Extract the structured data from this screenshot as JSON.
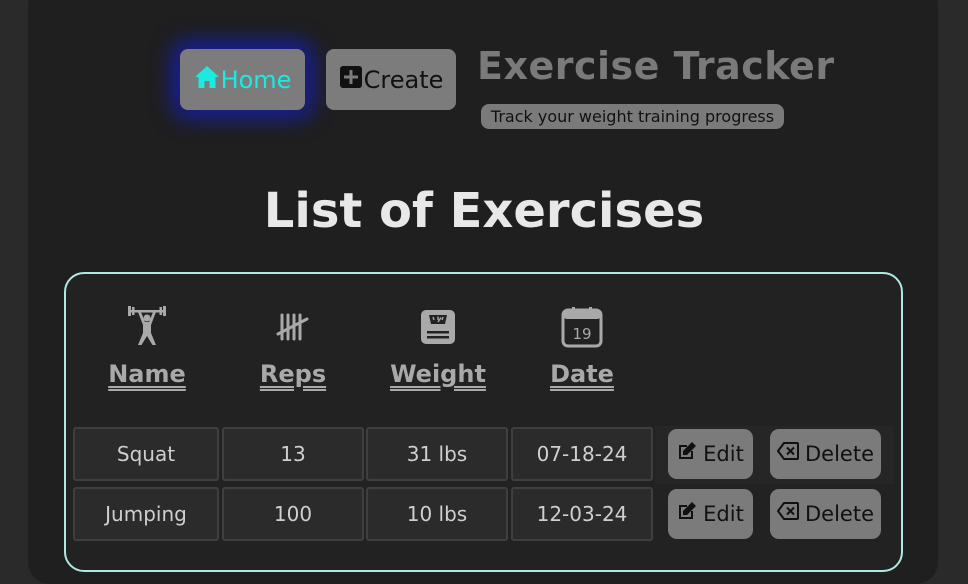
{
  "nav": {
    "home_label": "Home",
    "create_label": "Create"
  },
  "header": {
    "title": "Exercise Tracker",
    "subtitle": "Track your weight training progress"
  },
  "page": {
    "heading": "List of Exercises"
  },
  "table": {
    "columns": [
      {
        "label": "Name",
        "icon": "weightlifter-icon"
      },
      {
        "label": "Reps",
        "icon": "tally-marks-icon"
      },
      {
        "label": "Weight",
        "icon": "scale-icon"
      },
      {
        "label": "Date",
        "icon": "calendar-icon",
        "icon_text": "19"
      }
    ],
    "rows": [
      {
        "name": "Squat",
        "reps": "13",
        "weight": "31 lbs",
        "date": "07-18-24"
      },
      {
        "name": "Jumping",
        "reps": "100",
        "weight": "10 lbs",
        "date": "12-03-24"
      }
    ],
    "edit_label": "Edit",
    "delete_label": "Delete"
  },
  "colors": {
    "accent_cyan": "#1de9e0",
    "button_gray": "#7c7c7c",
    "panel_border": "#aee8e2",
    "home_glow": "#141ec8"
  }
}
